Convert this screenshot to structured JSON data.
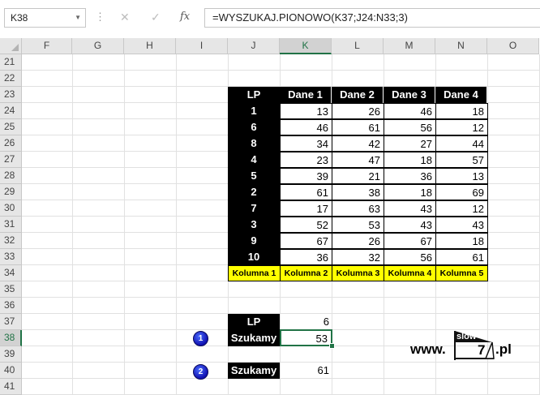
{
  "name_box": "K38",
  "formula": "=WYSZUKAJ.PIONOWO(K37;J24:N33;3)",
  "columns": [
    "F",
    "G",
    "H",
    "I",
    "J",
    "K",
    "L",
    "M",
    "N",
    "O"
  ],
  "rows": [
    "21",
    "22",
    "23",
    "24",
    "25",
    "26",
    "27",
    "28",
    "29",
    "30",
    "31",
    "32",
    "33",
    "34",
    "35",
    "36",
    "37",
    "38",
    "39",
    "40",
    "41"
  ],
  "table": {
    "headers": [
      "LP",
      "Dane 1",
      "Dane 2",
      "Dane 3",
      "Dane 4"
    ],
    "rows": [
      {
        "lp": "1",
        "v": [
          "13",
          "26",
          "46",
          "18"
        ]
      },
      {
        "lp": "6",
        "v": [
          "46",
          "61",
          "56",
          "12"
        ]
      },
      {
        "lp": "8",
        "v": [
          "34",
          "42",
          "27",
          "44"
        ]
      },
      {
        "lp": "4",
        "v": [
          "23",
          "47",
          "18",
          "57"
        ]
      },
      {
        "lp": "5",
        "v": [
          "39",
          "21",
          "36",
          "13"
        ]
      },
      {
        "lp": "2",
        "v": [
          "61",
          "38",
          "18",
          "69"
        ]
      },
      {
        "lp": "7",
        "v": [
          "17",
          "63",
          "43",
          "12"
        ]
      },
      {
        "lp": "3",
        "v": [
          "52",
          "53",
          "43",
          "43"
        ]
      },
      {
        "lp": "9",
        "v": [
          "67",
          "26",
          "67",
          "18"
        ]
      },
      {
        "lp": "10",
        "v": [
          "36",
          "32",
          "56",
          "61"
        ]
      }
    ],
    "footer": [
      "Kolumna 1",
      "Kolumna 2",
      "Kolumna 3",
      "Kolumna 4",
      "Kolumna 5"
    ]
  },
  "lookup": {
    "lp_label": "LP",
    "lp_value": "6",
    "s1_label": "Szukamy",
    "s1_value": "53",
    "s2_label": "Szukamy",
    "s2_value": "61",
    "badge1": "1",
    "badge2": "2"
  },
  "logo": {
    "www": "www.",
    "slow": "slow",
    "seven": "7",
    "tail": ".pl"
  },
  "colors": {
    "accent": "#217346",
    "header_bg": "#000000",
    "footer_bg": "#ffff00",
    "badge": "#1a1acc"
  }
}
